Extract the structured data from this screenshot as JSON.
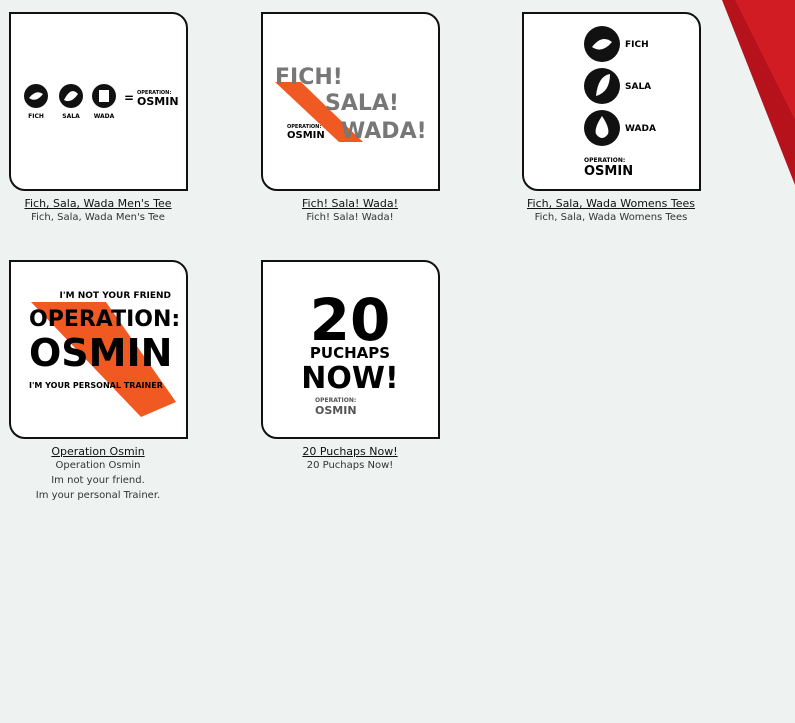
{
  "products": [
    {
      "title": "Fich, Sala, Wada Men's Tee",
      "desc": [
        "Fich, Sala, Wada Men's Tee"
      ],
      "art": {
        "icons": [
          "FICH",
          "SALA",
          "WADA"
        ],
        "equals": "=",
        "brand_top": "OPERATION:",
        "brand_bottom": "OSMIN"
      }
    },
    {
      "title": "Fich! Sala! Wada!",
      "desc": [
        "Fich! Sala! Wada!"
      ],
      "art": {
        "line1": "FICH!",
        "line2": "SALA!",
        "line3": "WADA!",
        "brand_top": "OPERATION:",
        "brand_bottom": "OSMIN"
      }
    },
    {
      "title": "Fich, Sala, Wada Womens Tees",
      "desc": [
        "Fich, Sala, Wada Womens Tees"
      ],
      "art": {
        "icons": [
          "FICH",
          "SALA",
          "WADA"
        ],
        "brand_top": "OPERATION:",
        "brand_bottom": "OSMIN"
      }
    },
    {
      "title": "Operation Osmin",
      "desc": [
        "Operation Osmin",
        "Im not your friend.",
        "Im your personal Trainer."
      ],
      "art": {
        "top": "I'M NOT YOUR FRIEND",
        "big1": "OPERATION:",
        "big2": "OSMIN",
        "bottom": "I'M YOUR PERSONAL TRAINER"
      }
    },
    {
      "title": "20 Puchaps Now!",
      "desc": [
        "20 Puchaps Now!"
      ],
      "art": {
        "number": "20",
        "line1": "PUCHAPS",
        "line2": "NOW!",
        "brand_top": "OPERATION:",
        "brand_bottom": "OSMIN"
      }
    }
  ],
  "colors": {
    "accent_orange": "#f05a22",
    "corner_red": "#c4161c",
    "gray_text": "#777777"
  }
}
